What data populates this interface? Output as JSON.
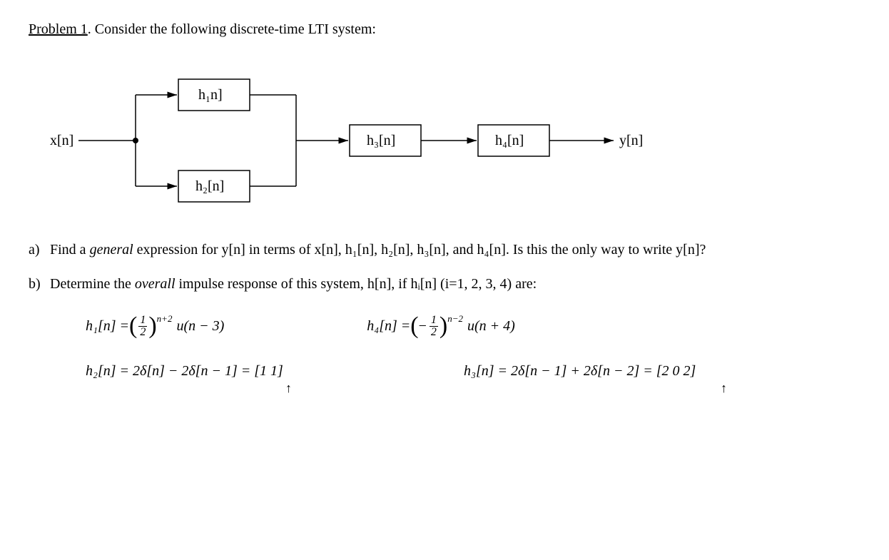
{
  "title_label": "Problem 1",
  "title_rest": ".  Consider the following discrete-time LTI system:",
  "diagram": {
    "input": "x[n]",
    "output": "y[n]",
    "h1": "h₁n]",
    "h2": "h₂[n]",
    "h3": "h₃[n]",
    "h4": "h₄[n]"
  },
  "parts": {
    "a_label": "a)",
    "a_text_1": "Find a ",
    "a_text_italic": "general",
    "a_text_2": " expression for y[n] in terms of x[n], h₁[n], h₂[n], h₃[n], and h₄[n].  Is this the only way to write y[n]?",
    "b_label": "b)",
    "b_text_1": "Determine the ",
    "b_text_italic": "overall",
    "b_text_2": " impulse response of this system, h[n], if hᵢ[n] (i=1, 2, 3, 4) are:"
  },
  "equations": {
    "h1_lhs": "h₁[n] = ",
    "h1_exp": "n+2",
    "h1_rhs": "u(n − 3)",
    "h4_lhs": "h₄[n] = ",
    "h4_exp": "n−2",
    "h4_rhs": "u(n + 4)",
    "h2_full": "h₂[n] = 2δ[n] − 2δ[n − 1]  =  [1   1]",
    "h3_full": "h₃[n] = 2δ[n − 1] + 2δ[n − 2]  =  [2   0   2]",
    "arrow": "↑"
  }
}
